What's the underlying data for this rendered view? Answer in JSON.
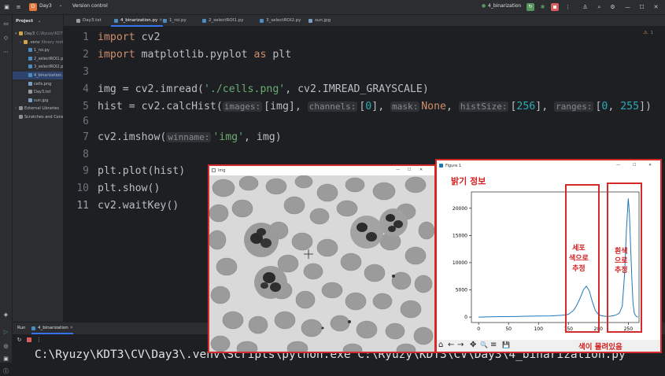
{
  "titlebar": {
    "project": "Day3",
    "project_badge": "D",
    "vcs": "Version control",
    "run_config": "4_binarization",
    "colors": {
      "badge": "#e5763c",
      "run": "#57965c",
      "stop": "#db5c5c"
    }
  },
  "project_panel": {
    "title": "Project",
    "items": [
      {
        "label": "Day3",
        "suffix": "C:\\Ryuzy\\KDT3\\CV\\Day3",
        "indent": 0,
        "arrow": "▾",
        "color": "#d3a54a"
      },
      {
        "label": ".venv",
        "suffix": "library root",
        "indent": 1,
        "arrow": "›",
        "color": "#d3a54a"
      },
      {
        "label": "1_roi.py",
        "indent": 2,
        "color": "#4b8bbe"
      },
      {
        "label": "2_selectROI1.py",
        "indent": 2,
        "color": "#4b8bbe"
      },
      {
        "label": "3_selectROI2.py",
        "indent": 2,
        "color": "#4b8bbe"
      },
      {
        "label": "4_binarization.py",
        "indent": 2,
        "color": "#4b8bbe",
        "selected": true
      },
      {
        "label": "cells.png",
        "indent": 2,
        "color": "#7c9dc7"
      },
      {
        "label": "Day3.txt",
        "indent": 2,
        "color": "#9a9a9a"
      },
      {
        "label": "sun.jpg",
        "indent": 2,
        "color": "#7c9dc7"
      },
      {
        "label": "External Libraries",
        "indent": 0,
        "arrow": "›",
        "color": "#8f8f8f"
      },
      {
        "label": "Scratches and Consoles",
        "indent": 0,
        "color": "#8f8f8f"
      }
    ]
  },
  "tabs": [
    {
      "label": "Day3.txt",
      "color": "#9a9a9a"
    },
    {
      "label": "4_binarization.py",
      "color": "#4b8bbe",
      "active": true
    },
    {
      "label": "1_roi.py",
      "color": "#4b8bbe"
    },
    {
      "label": "2_selectROI1.py",
      "color": "#4b8bbe"
    },
    {
      "label": "3_selectROI2.py",
      "color": "#4b8bbe"
    },
    {
      "label": "sun.jpg",
      "color": "#7c9dc7"
    }
  ],
  "editor": {
    "warnings": "1",
    "line_numbers": [
      "1",
      "2",
      "3",
      "4",
      "5",
      "6",
      "7",
      "8",
      "9",
      "10",
      "11"
    ],
    "current_line": "11"
  },
  "code_tokens": {
    "l1": [
      "import",
      " cv2"
    ],
    "l2": [
      "import",
      " matplotlib.pyplot ",
      "as",
      " plt"
    ],
    "l4": [
      "img = cv2.imread(",
      "'./cells.png'",
      ", cv2.IMREAD_GRAYSCALE)"
    ],
    "l5": [
      "hist = cv2.calcHist(",
      "images:",
      "[img], ",
      "channels:",
      "[",
      "0",
      "], ",
      "mask:",
      "None",
      ", ",
      "histSize:",
      "[",
      "256",
      "], ",
      "ranges:",
      "[",
      "0",
      ", ",
      "255",
      "])"
    ],
    "l7": [
      "cv2.imshow(",
      "winname:",
      "'img'",
      ", img)"
    ],
    "l9": [
      "plt.plot(hist)"
    ],
    "l10": [
      "plt.show()"
    ],
    "l11": [
      "cv2.waitKey()"
    ]
  },
  "run_panel": {
    "label": "Run",
    "tab": "4_binarization",
    "console_line": "C:\\Ryuzy\\KDT3\\CV\\Day3\\.venv\\Scripts\\python.exe C:\\Ryuzy\\KDT3\\CV\\Day3\\4_binarization.py"
  },
  "img_window": {
    "title": "img",
    "controls": [
      "—",
      "☐",
      "✕"
    ]
  },
  "plot_window": {
    "title": "Figure 1",
    "controls": [
      "—",
      "☐",
      "✕"
    ],
    "annotation_title": "밝기 정보",
    "annotation_cell": [
      "세포",
      "색으로",
      "추정"
    ],
    "annotation_white": [
      "흰색",
      "으로",
      "추정"
    ],
    "annotation_bottom": "색이 몰려있음",
    "toolbar_icons": [
      "home-icon",
      "back-icon",
      "forward-icon",
      "pan-icon",
      "zoom-icon",
      "configure-icon",
      "save-icon"
    ],
    "toolbar_glyphs": [
      "⌂",
      "←",
      "→",
      "✥",
      "🔍",
      "≡",
      "💾"
    ]
  },
  "chart_data": {
    "type": "line",
    "title": "",
    "xlabel": "",
    "ylabel": "",
    "xlim": [
      -12,
      268
    ],
    "ylim": [
      -1000,
      23000
    ],
    "xticks": [
      0,
      50,
      100,
      150,
      200,
      250
    ],
    "yticks": [
      0,
      5000,
      10000,
      15000,
      20000
    ],
    "series": [
      {
        "color": "#1f77b4",
        "x": [
          0,
          20,
          40,
          60,
          80,
          100,
          120,
          140,
          150,
          155,
          160,
          165,
          170,
          175,
          180,
          185,
          190,
          195,
          200,
          205,
          210,
          215,
          220,
          225,
          230,
          235,
          240,
          244,
          247,
          250,
          252,
          254,
          256,
          258,
          260,
          262,
          264,
          266
        ],
        "y": [
          0,
          40,
          80,
          100,
          150,
          180,
          220,
          350,
          500,
          900,
          1400,
          2400,
          3600,
          5000,
          5700,
          4800,
          2800,
          1200,
          500,
          250,
          150,
          120,
          150,
          250,
          400,
          700,
          2000,
          8000,
          16000,
          21800,
          19000,
          13000,
          7000,
          2500,
          800,
          300,
          100,
          0
        ]
      }
    ],
    "grid": false
  }
}
